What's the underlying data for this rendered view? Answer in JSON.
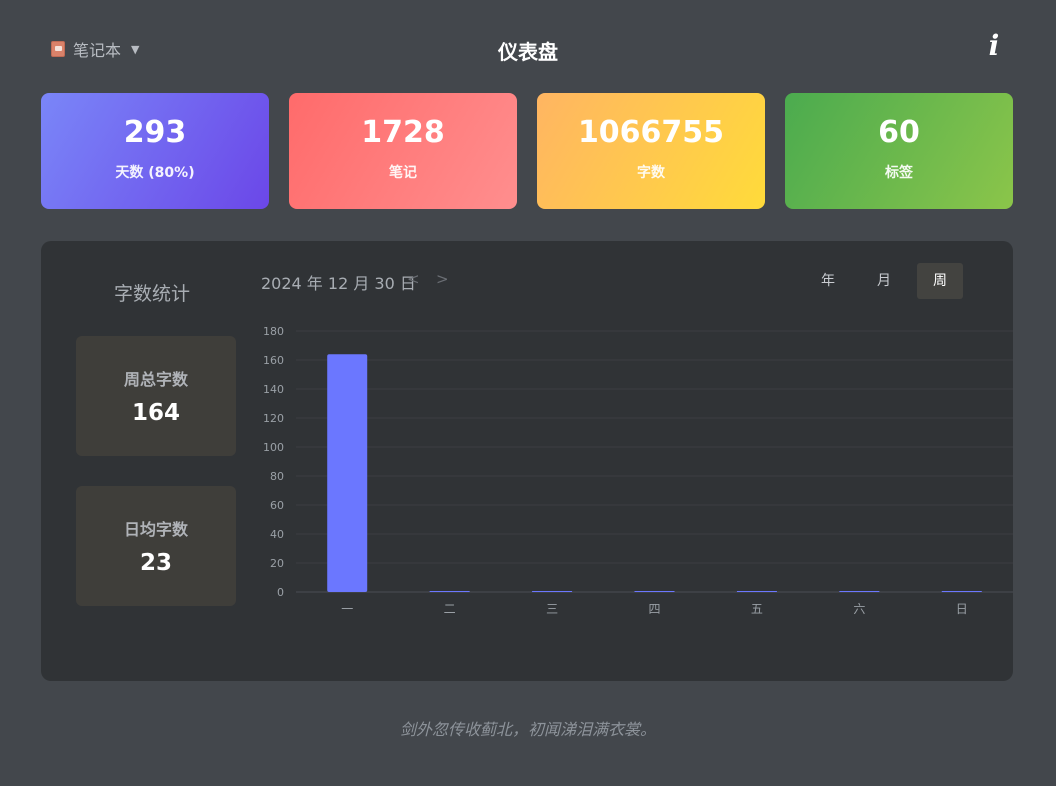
{
  "header": {
    "notebook_label": "笔记本",
    "notebook_caret": "▼",
    "title": "仪表盘",
    "info_label": "i"
  },
  "cards": {
    "days": {
      "value": "293",
      "label": "天数 (80%)"
    },
    "notes": {
      "value": "1728",
      "label": "笔记"
    },
    "words": {
      "value": "1066755",
      "label": "字数"
    },
    "tags": {
      "value": "60",
      "label": "标签"
    }
  },
  "stats": {
    "title": "字数统计",
    "date": "2024 年 12 月 30 日",
    "prev": "<",
    "next": ">",
    "periods": {
      "year": "年",
      "month": "月",
      "week": "周"
    },
    "selected_period": "周",
    "weekly_total_label": "周总字数",
    "weekly_total_value": "164",
    "daily_avg_label": "日均字数",
    "daily_avg_value": "23"
  },
  "chart_data": {
    "type": "bar",
    "categories": [
      "一",
      "二",
      "三",
      "四",
      "五",
      "六",
      "日"
    ],
    "values": [
      164,
      0,
      0,
      0,
      0,
      0,
      0
    ],
    "ylim": [
      0,
      180
    ],
    "yticks": [
      0,
      20,
      40,
      60,
      80,
      100,
      120,
      140,
      160,
      180
    ],
    "grid": true,
    "bar_color": "#6b77ff"
  },
  "footer": {
    "quote": "剑外忽传收蓟北，初闻涕泪满衣裳。"
  }
}
